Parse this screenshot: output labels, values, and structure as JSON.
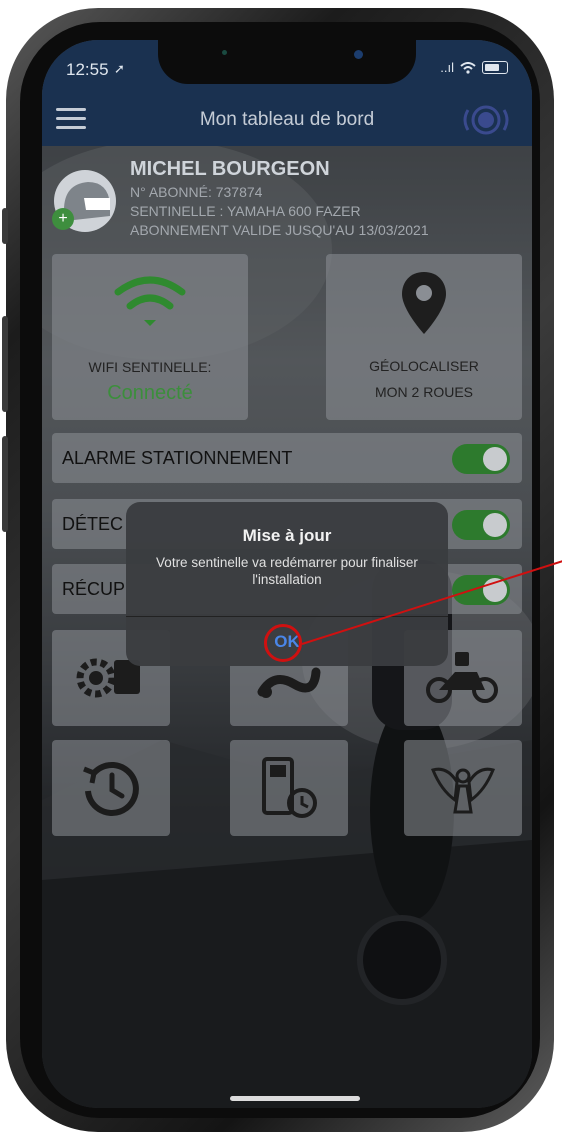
{
  "status_bar": {
    "time": "12:55",
    "signal": "..ıl",
    "wifi": "wifi-icon",
    "battery": "battery-icon"
  },
  "nav": {
    "title": "Mon tableau de bord",
    "menu_icon": "hamburger-icon",
    "right_icon": "alarm-signal-icon"
  },
  "profile": {
    "name": "MICHEL BOURGEON",
    "subscriber": "N° ABONNÉ: 737874",
    "sentinel": "SENTINELLE : YAMAHA 600 FAZER",
    "validity": "ABONNEMENT VALIDE JUSQU'AU 13/03/2021"
  },
  "tiles": {
    "wifi": {
      "label": "WIFI SENTINELLE:",
      "status": "Connecté",
      "icon": "wifi-icon"
    },
    "geo": {
      "line1": "GÉOLOCALISER",
      "line2": "MON 2 ROUES",
      "icon": "map-pin-icon"
    }
  },
  "toggles": [
    {
      "label": "ALARME STATIONNEMENT",
      "on": true
    },
    {
      "label": "DÉTEC",
      "on": true
    },
    {
      "label": "RÉCUP",
      "on": true
    }
  ],
  "icon_tiles": [
    "gear-truck-icon",
    "route-icon",
    "motorbike-icon",
    "history-icon",
    "fuel-timer-icon",
    "angel-icon"
  ],
  "dialog": {
    "title": "Mise à jour",
    "message": "Votre sentinelle va redémarrer pour finaliser l'installation",
    "ok_label": "OK"
  },
  "colors": {
    "nav_bg": "#1a3150",
    "connected": "#3c8e3c",
    "toggle_on": "#2d7a2d",
    "ok": "#4a86e8",
    "annotation": "#d01010"
  }
}
